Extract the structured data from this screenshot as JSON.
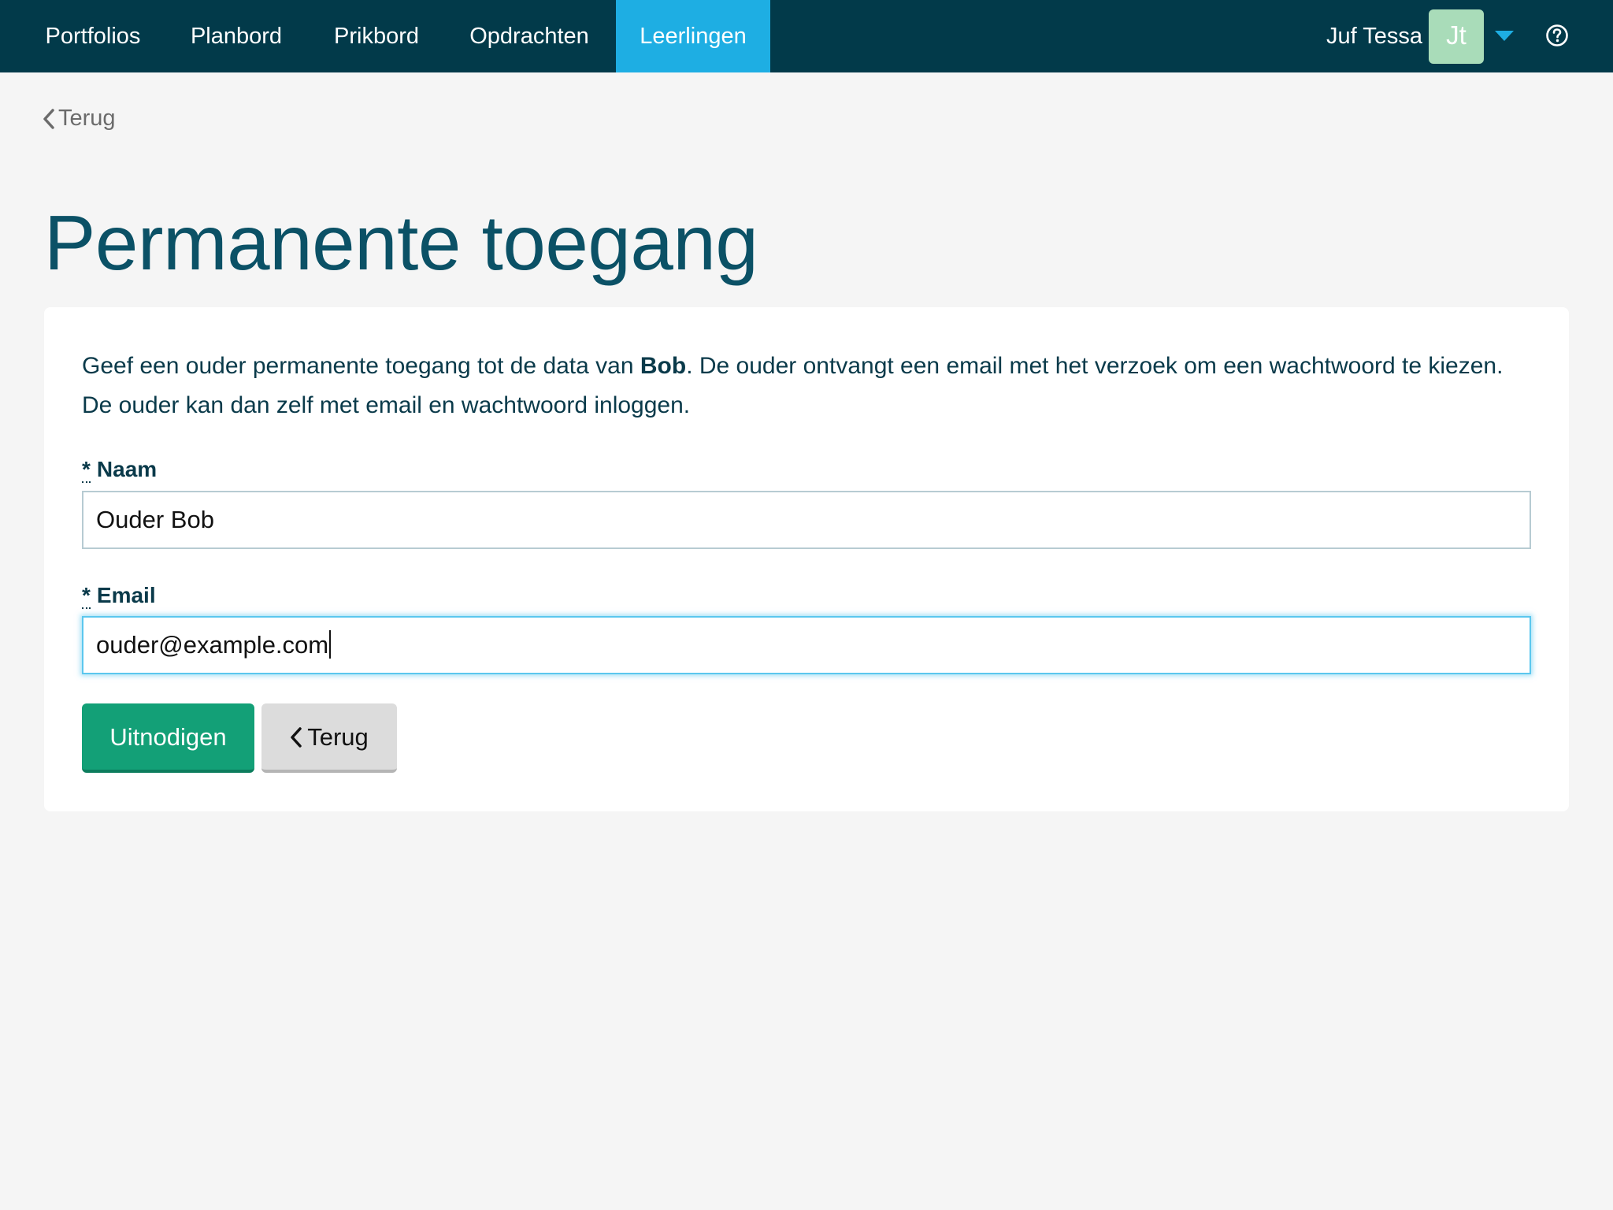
{
  "nav": {
    "items": [
      {
        "label": "Portfolios"
      },
      {
        "label": "Planbord"
      },
      {
        "label": "Prikbord"
      },
      {
        "label": "Opdrachten"
      },
      {
        "label": "Leerlingen",
        "active": true
      }
    ],
    "user_name": "Juf Tessa",
    "avatar_initials": "Jt",
    "icons": {
      "dropdown": "caret-down-icon",
      "help": "question-circle-icon"
    }
  },
  "back_link": {
    "label": "Terug"
  },
  "page": {
    "title": "Permanente toegang"
  },
  "form": {
    "intro_before": "Geef een ouder permanente toegang tot de data van ",
    "intro_student": "Bob",
    "intro_after": ". De ouder ontvangt een email met het verzoek om een wachtwoord te kiezen. De ouder kan dan zelf met email en wachtwoord inloggen.",
    "required_marker": "*",
    "name_label": "Naam",
    "name_value": "Ouder Bob",
    "email_label": "Email",
    "email_value": "ouder@example.com",
    "submit_label": "Uitnodigen",
    "back_label": "Terug"
  },
  "colors": {
    "nav_bg": "#023a4a",
    "nav_active": "#1eaee3",
    "title": "#0b5166",
    "primary_button": "#13a077",
    "avatar_bg": "#a9dcb9"
  }
}
